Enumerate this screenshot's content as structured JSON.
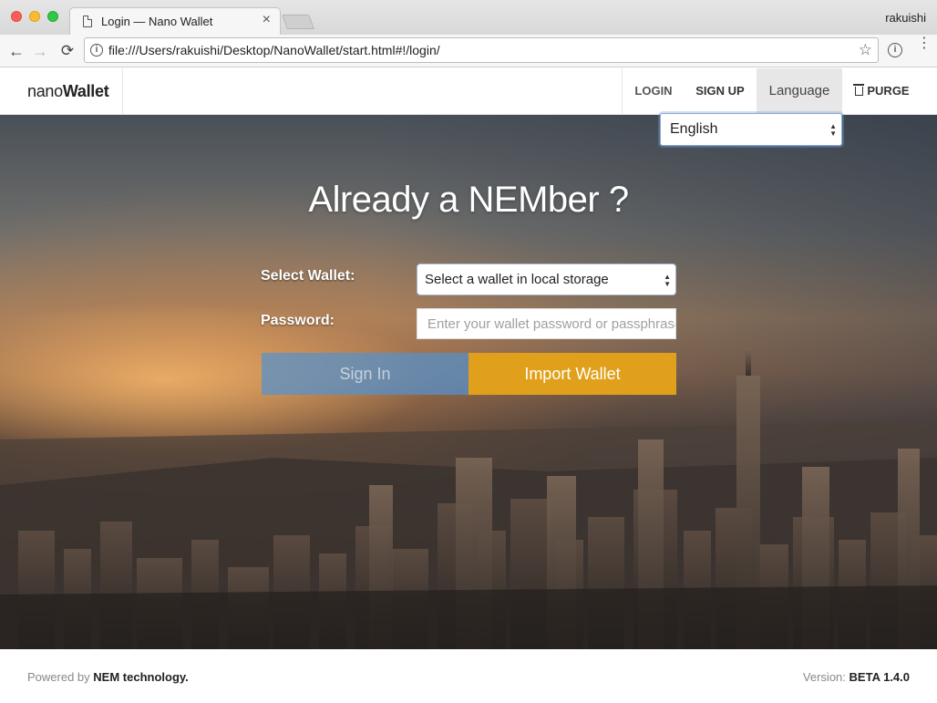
{
  "browser": {
    "tab_title": "Login — Nano Wallet",
    "tab_close": "×",
    "profile_name": "rakuishi",
    "url": "file:///Users/rakuishi/Desktop/NanoWallet/start.html#!/login/",
    "icons": {
      "back": "←",
      "forward": "→",
      "reload": "⟳",
      "star": "☆",
      "info": "i",
      "menu": "⋮"
    }
  },
  "navbar": {
    "brand_light": "nano",
    "brand_bold": "Wallet",
    "items": {
      "login": "LOGIN",
      "signup": "SIGN UP",
      "language": "Language",
      "purge": "PURGE"
    },
    "language_select": {
      "selected": "English"
    }
  },
  "login": {
    "headline": "Already a NEMber ?",
    "select_wallet_label": "Select Wallet:",
    "select_wallet_value": "Select a wallet in local storage",
    "password_label": "Password:",
    "password_placeholder": "Enter your wallet password or passphrase",
    "sign_in_button": "Sign In",
    "import_button": "Import Wallet"
  },
  "footer": {
    "powered_prefix": "Powered by",
    "powered_brand": "NEM technology.",
    "version_prefix": "Version:",
    "version_value": "BETA 1.4.0"
  },
  "colors": {
    "import_button": "#e1a01b",
    "sign_in_button": "#5491cd",
    "language_active_bg": "#e7e7e7"
  }
}
